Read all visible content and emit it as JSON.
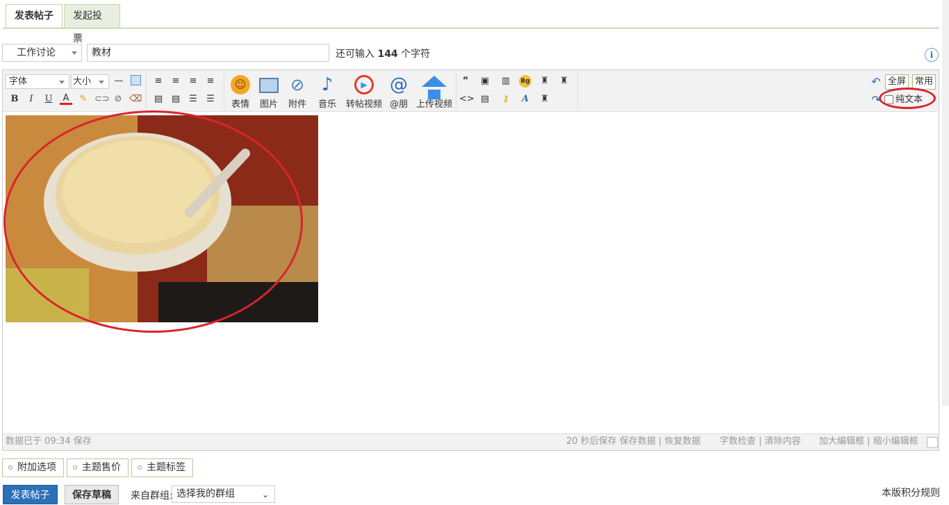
{
  "tabs": [
    {
      "label": "发表帖子",
      "active": true
    },
    {
      "label": "发起投票",
      "active": false
    }
  ],
  "post": {
    "category": "工作讨论",
    "title": "教材",
    "remaining_prefix": "还可输入",
    "remaining_count": "144",
    "remaining_suffix": "个字符"
  },
  "toolbar": {
    "font_label": "字体",
    "size_label": "大小",
    "big_buttons": [
      "表情",
      "图片",
      "附件",
      "音乐",
      "转帖视频",
      "@朋",
      "上传视频"
    ],
    "fullscreen": "全屏",
    "common": "常用",
    "plaintext": "纯文本"
  },
  "image": {
    "description_icon": "soy-milk-bowl-photo"
  },
  "status": {
    "saved": "数据已于 09:34 保存",
    "autosave": "20 秒后保存",
    "save_data": "保存数据",
    "restore_data": "恢复数据",
    "word_check": "字数检查",
    "clear_content": "清除内容",
    "enlarge": "加大编辑框",
    "shrink": "缩小编辑框"
  },
  "options": [
    "附加选项",
    "主题售价",
    "主题标签"
  ],
  "actions": {
    "submit": "发表帖子",
    "draft": "保存草稿",
    "group_label": "来自群组:",
    "group_select": "选择我的群组",
    "rules": "本版积分规则"
  },
  "colors": {
    "accent": "#2b6fb8",
    "tab_border": "#9fc27a",
    "annotation": "#d9232e"
  }
}
